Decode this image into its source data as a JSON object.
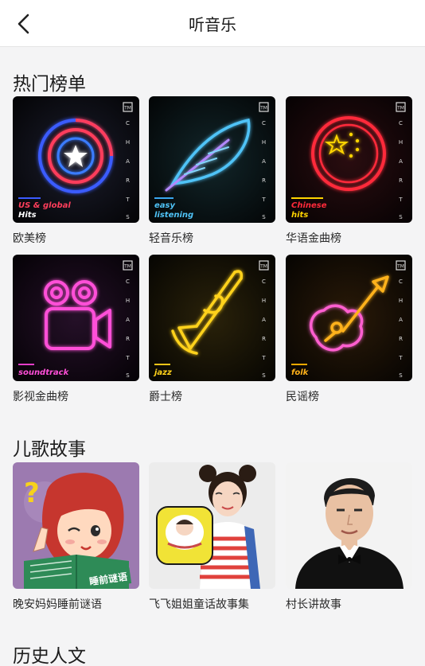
{
  "header": {
    "title": "听音乐"
  },
  "sections": {
    "charts": {
      "title": "热门榜单"
    },
    "kids": {
      "title": "儿歌故事"
    },
    "history": {
      "title": "历史人文"
    }
  },
  "charts": [
    {
      "name": "欧美榜",
      "tag_line1": "US & global",
      "tag_line2": "Hits",
      "icon": "star-target-icon",
      "accent": "#e0324a"
    },
    {
      "name": "轻音乐榜",
      "tag_line1": "easy",
      "tag_line2": "listening",
      "icon": "feather-icon",
      "accent": "#3aa7f0"
    },
    {
      "name": "华语金曲榜",
      "tag_line1": "Chinese",
      "tag_line2": "hits",
      "icon": "china-flag-icon",
      "accent": "#e52a2a"
    },
    {
      "name": "影视金曲榜",
      "tag_line1": "soundtrack",
      "tag_line2": "",
      "icon": "film-camera-icon",
      "accent": "#e43ec8"
    },
    {
      "name": "爵士榜",
      "tag_line1": "jazz",
      "tag_line2": "",
      "icon": "trumpet-icon",
      "accent": "#f5c518"
    },
    {
      "name": "民谣榜",
      "tag_line1": "folk",
      "tag_line2": "",
      "icon": "guitar-icon",
      "accent": "#f2a900"
    }
  ],
  "chart_logo": {
    "mark": "TM",
    "letters": [
      "C",
      "H",
      "A",
      "R",
      "T",
      "S"
    ]
  },
  "kids": [
    {
      "name": "晚安妈妈睡前谜语",
      "image_text": "睡前谜语",
      "icon": "cartoon-girl-illustration"
    },
    {
      "name": "飞飞姐姐童话故事集",
      "icon": "storyteller-photo"
    },
    {
      "name": "村长讲故事",
      "icon": "host-photo"
    }
  ]
}
